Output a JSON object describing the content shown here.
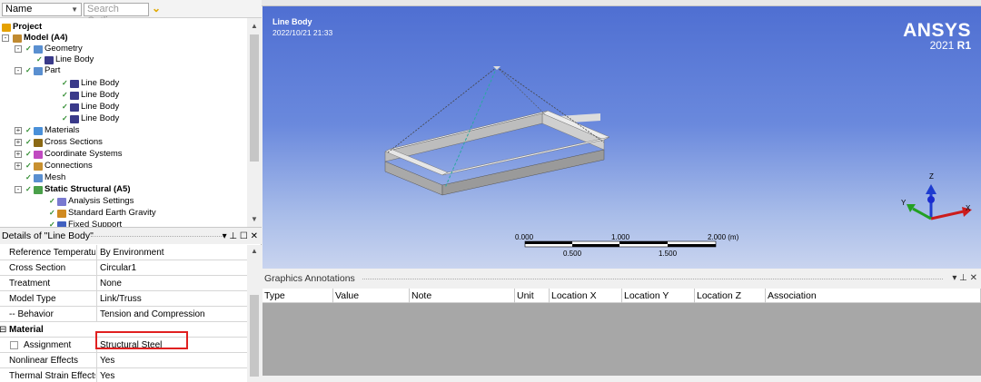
{
  "outline": {
    "name_combo": "Name",
    "search_placeholder": "Search Outline",
    "tree": [
      {
        "label": "Project",
        "bold": true
      },
      {
        "label": "Model (A4)",
        "bold": true
      },
      {
        "label": "Geometry"
      },
      {
        "label": "Line Body"
      },
      {
        "label": "Part"
      },
      {
        "label": "Line Body"
      },
      {
        "label": "Line Body"
      },
      {
        "label": "Line Body"
      },
      {
        "label": "Line Body"
      },
      {
        "label": "Materials"
      },
      {
        "label": "Cross Sections"
      },
      {
        "label": "Coordinate Systems"
      },
      {
        "label": "Connections"
      },
      {
        "label": "Mesh"
      },
      {
        "label": "Static Structural (A5)",
        "bold": true
      },
      {
        "label": "Analysis Settings"
      },
      {
        "label": "Standard Earth Gravity"
      },
      {
        "label": "Fixed Support"
      }
    ]
  },
  "details": {
    "title": "Details of \"Line Body\"",
    "rows": [
      {
        "key": "Reference Temperature",
        "value": "By Environment"
      },
      {
        "key": "Cross Section",
        "value": "Circular1"
      },
      {
        "key": "Treatment",
        "value": "None"
      },
      {
        "key": "Model Type",
        "value": "Link/Truss"
      },
      {
        "key": "-- Behavior",
        "value": "Tension and Compression"
      },
      {
        "key": "Material",
        "value": "",
        "section": true
      },
      {
        "key": "Assignment",
        "value": "Structural Steel"
      },
      {
        "key": "Nonlinear Effects",
        "value": "Yes"
      },
      {
        "key": "Thermal Strain Effects",
        "value": "Yes"
      }
    ]
  },
  "viewport": {
    "title": "Line Body",
    "date": "2022/10/21 21:33",
    "logo_main": "ANSYS",
    "logo_version": "2021",
    "logo_release": "R1",
    "scale": {
      "labels_top": [
        "0.000",
        "1.000",
        "2.000 (m)"
      ],
      "labels_bottom": [
        "0.500",
        "1.500"
      ]
    },
    "axes": {
      "x": "X",
      "y": "Y",
      "z": "Z"
    }
  },
  "annotations": {
    "title": "Graphics Annotations",
    "columns": [
      "Type",
      "Value",
      "Note",
      "Unit",
      "Location X",
      "Location Y",
      "Location Z",
      "Association"
    ]
  },
  "colors": {
    "viewport_top": "#4f6fd2",
    "viewport_bottom": "#c9d4ef",
    "highlight": "#e02020"
  }
}
